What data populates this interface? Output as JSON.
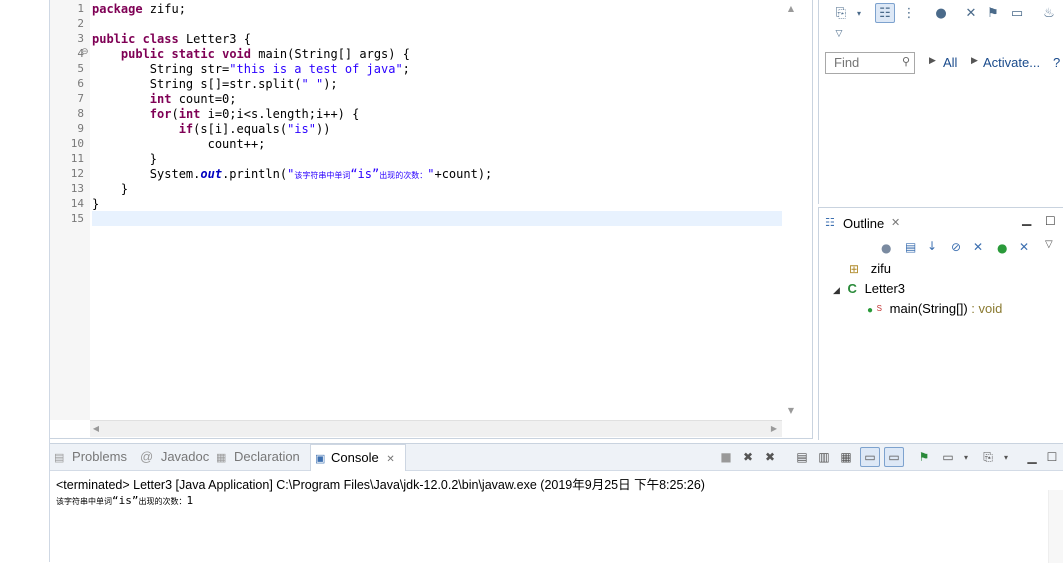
{
  "editor": {
    "line_numbers": [
      "1",
      "2",
      "3",
      "4",
      "5",
      "6",
      "7",
      "8",
      "9",
      "10",
      "11",
      "12",
      "13",
      "14",
      "15"
    ],
    "lines": [
      [
        {
          "t": "package",
          "c": "kw"
        },
        {
          "t": " zifu;",
          "c": ""
        }
      ],
      [],
      [
        {
          "t": "public",
          "c": "kw"
        },
        {
          "t": " ",
          "c": ""
        },
        {
          "t": "class",
          "c": "kw"
        },
        {
          "t": " Letter3 {",
          "c": ""
        }
      ],
      [
        {
          "t": "    ",
          "c": ""
        },
        {
          "t": "public",
          "c": "kw"
        },
        {
          "t": " ",
          "c": ""
        },
        {
          "t": "static",
          "c": "kw"
        },
        {
          "t": " ",
          "c": ""
        },
        {
          "t": "void",
          "c": "kw"
        },
        {
          "t": " main(String[] args) {",
          "c": ""
        }
      ],
      [
        {
          "t": "        String str=",
          "c": ""
        },
        {
          "t": "\"this is a test of java\"",
          "c": "str"
        },
        {
          "t": ";",
          "c": ""
        }
      ],
      [
        {
          "t": "        String s[]=str.split(",
          "c": ""
        },
        {
          "t": "\" \"",
          "c": "str"
        },
        {
          "t": ");",
          "c": ""
        }
      ],
      [
        {
          "t": "        ",
          "c": ""
        },
        {
          "t": "int",
          "c": "kw"
        },
        {
          "t": " count=0;",
          "c": ""
        }
      ],
      [
        {
          "t": "        ",
          "c": ""
        },
        {
          "t": "for",
          "c": "kw"
        },
        {
          "t": "(",
          "c": ""
        },
        {
          "t": "int",
          "c": "kw"
        },
        {
          "t": " i=0;i<s.length;i++) {",
          "c": ""
        }
      ],
      [
        {
          "t": "            ",
          "c": ""
        },
        {
          "t": "if",
          "c": "kw"
        },
        {
          "t": "(s[i].equals(",
          "c": ""
        },
        {
          "t": "\"is\"",
          "c": "str"
        },
        {
          "t": "))",
          "c": ""
        }
      ],
      [
        {
          "t": "                count++;",
          "c": ""
        }
      ],
      [
        {
          "t": "        }",
          "c": ""
        }
      ],
      [
        {
          "t": "        System.",
          "c": ""
        },
        {
          "t": "out",
          "c": "fld"
        },
        {
          "t": ".println(",
          "c": ""
        },
        {
          "t": "\"",
          "c": "str"
        },
        {
          "t": "该字符串中单词",
          "c": "cn"
        },
        {
          "t": "“is”",
          "c": "str"
        },
        {
          "t": "出现的次数：",
          "c": "cn"
        },
        {
          "t": "\"",
          "c": "str"
        },
        {
          "t": "+count);",
          "c": ""
        }
      ],
      [
        {
          "t": "    }",
          "c": ""
        }
      ],
      [
        {
          "t": "}",
          "c": ""
        }
      ],
      []
    ]
  },
  "right_top": {
    "find_placeholder": "Find",
    "all_link": "All",
    "activate_link": "Activate..."
  },
  "outline": {
    "tab_label": "Outline",
    "package": "zifu",
    "class": "Letter3",
    "method": "main(String[])",
    "method_type": " : void"
  },
  "bottom": {
    "tabs": [
      "Problems",
      "Javadoc",
      "Declaration",
      "Console"
    ],
    "active_tab": "Console",
    "console_header": "<terminated> Letter3 [Java Application] C:\\Program Files\\Java\\jdk-12.0.2\\bin\\javaw.exe (2019年9月25日 下午8:25:26)",
    "console_output_prefix": "该字符串中单词",
    "console_output_is": "“is”",
    "console_output_suffix": "出现的次数：",
    "console_output_value": "1"
  },
  "colors": {
    "keyword": "#7f0055",
    "string": "#2a00ff",
    "field": "#0000c0",
    "current_line": "#e8f2fe",
    "link": "#1a4b8c"
  },
  "icons": {
    "toolbar_right": [
      "new-view-icon",
      "dropdown-icon",
      "hierarchy-icon",
      "tree-icon",
      "beans-icon",
      "link-icon",
      "pin-icon",
      "minimize-icon",
      "java-perspective-icon"
    ],
    "outline_toolbar": [
      "beans-icon",
      "collapse-all-icon",
      "sort-icon",
      "hide-fields-icon",
      "hide-static-icon",
      "hide-nonpublic-icon",
      "hide-local-icon",
      "view-menu-icon"
    ],
    "console_toolbar": [
      "terminate-icon",
      "remove-launch-icon",
      "remove-all-icon",
      "clear-console-icon",
      "scroll-lock-icon",
      "word-wrap-icon",
      "show-on-stdout-icon",
      "show-on-stderr-icon",
      "pin-console-icon",
      "display-console-icon",
      "open-console-icon",
      "minimize-icon"
    ]
  }
}
